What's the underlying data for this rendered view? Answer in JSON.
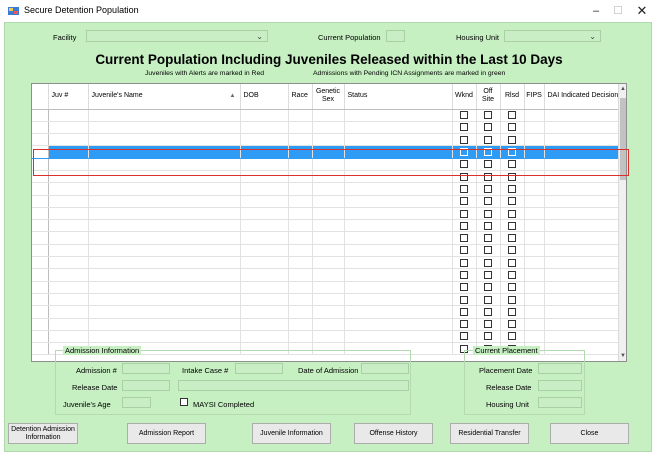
{
  "window": {
    "title": "Secure Detention Population",
    "minimize": "–",
    "maximize": "☐",
    "close": "✕"
  },
  "filters": {
    "facility_label": "Facility",
    "current_population_label": "Current Population",
    "housing_unit_label": "Housing Unit"
  },
  "heading": "Current Population Including Juveniles Released within the Last 10 Days",
  "notes": {
    "alerts": "Juveniles with Alerts are marked in Red",
    "pending": "Admissions with Pending ICN Assignments are marked in green"
  },
  "grid": {
    "columns": {
      "juv_num": "Juv #",
      "name": "Juvenile's Name",
      "sort_indicator": "▲",
      "dob": "DOB",
      "race": "Race",
      "genetic_sex": "Genetic Sex",
      "status": "Status",
      "wknd": "Wknd",
      "off_site": "Off Site",
      "rlsd": "Rlsd",
      "fips": "FIPS",
      "dai": "DAI Indicated Decision"
    }
  },
  "admission_info": {
    "title": "Admission Information",
    "admission_num": "Admission #",
    "intake_case": "Intake Case #",
    "date_of_admission": "Date of Admission",
    "release_date": "Release Date",
    "juvenile_age": "Juvenile's Age",
    "maysi": "MAYSI Completed"
  },
  "current_placement": {
    "title": "Current Placement",
    "placement_date": "Placement Date",
    "release_date": "Release Date",
    "housing_unit": "Housing Unit"
  },
  "buttons": {
    "detention_admission": "Detention Admission Information",
    "admission_report": "Admission Report",
    "juvenile_information": "Juvenile Information",
    "offense_history": "Offense History",
    "residential_transfer": "Residential Transfer",
    "close": "Close"
  }
}
